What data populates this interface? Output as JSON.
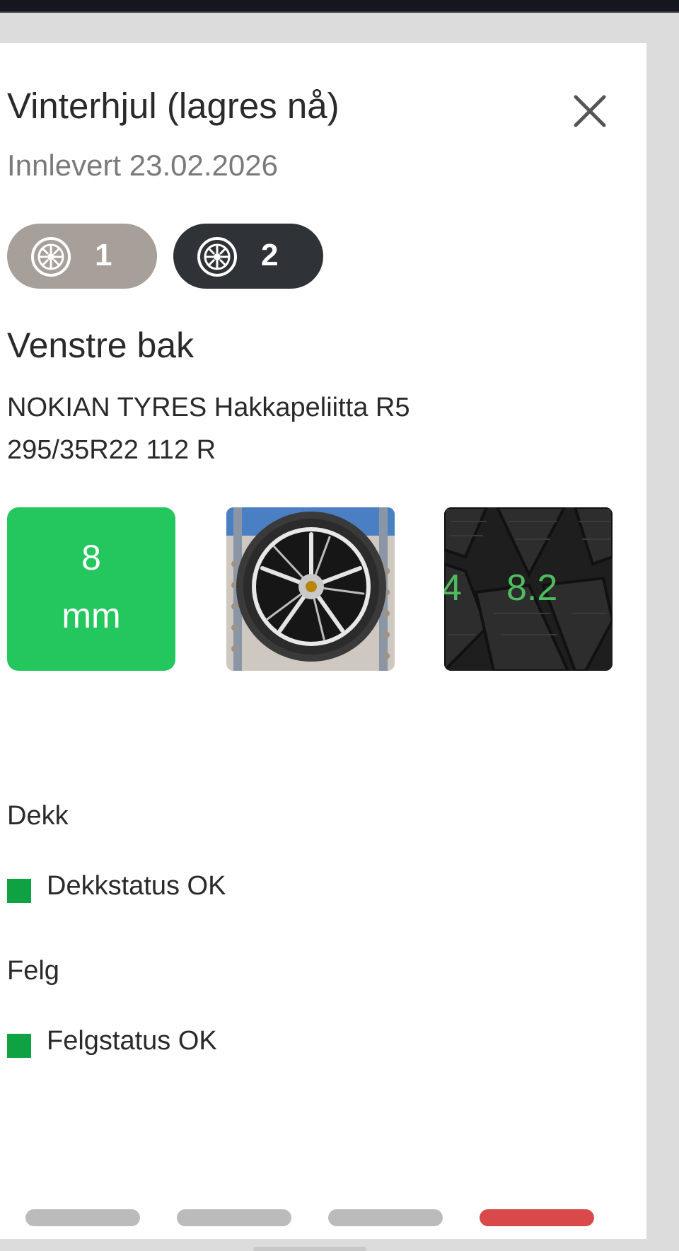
{
  "modal": {
    "title": "Vinterhjul (lagres nå)",
    "subtitle": "Innlevert 23.02.2026"
  },
  "sets": [
    {
      "label": "1",
      "icon": "wheel-icon",
      "selected": false
    },
    {
      "label": "2",
      "icon": "wheel-icon",
      "selected": true
    }
  ],
  "wheel": {
    "position": "Venstre bak",
    "tire_brand_model": "NOKIAN TYRES Hakkapeliitta R5",
    "tire_size": "295/35R22 112 R",
    "tread_value": "8",
    "tread_unit": "mm",
    "tread_photo_reading": "8.2",
    "tread_photo_side_text": "4"
  },
  "status": {
    "tire_heading": "Dekk",
    "tire_status": "Dekkstatus OK",
    "rim_heading": "Felg",
    "rim_status": "Felgstatus OK"
  },
  "pagination": {
    "count": 4,
    "active_index": 3
  },
  "colors": {
    "tread_good": "#24c65e",
    "status_ok": "#0fa243",
    "pill_inactive": "#a79f99",
    "pill_active": "#2f3236",
    "dot_inactive": "#bbbbbb",
    "dot_active": "#d9494a"
  }
}
